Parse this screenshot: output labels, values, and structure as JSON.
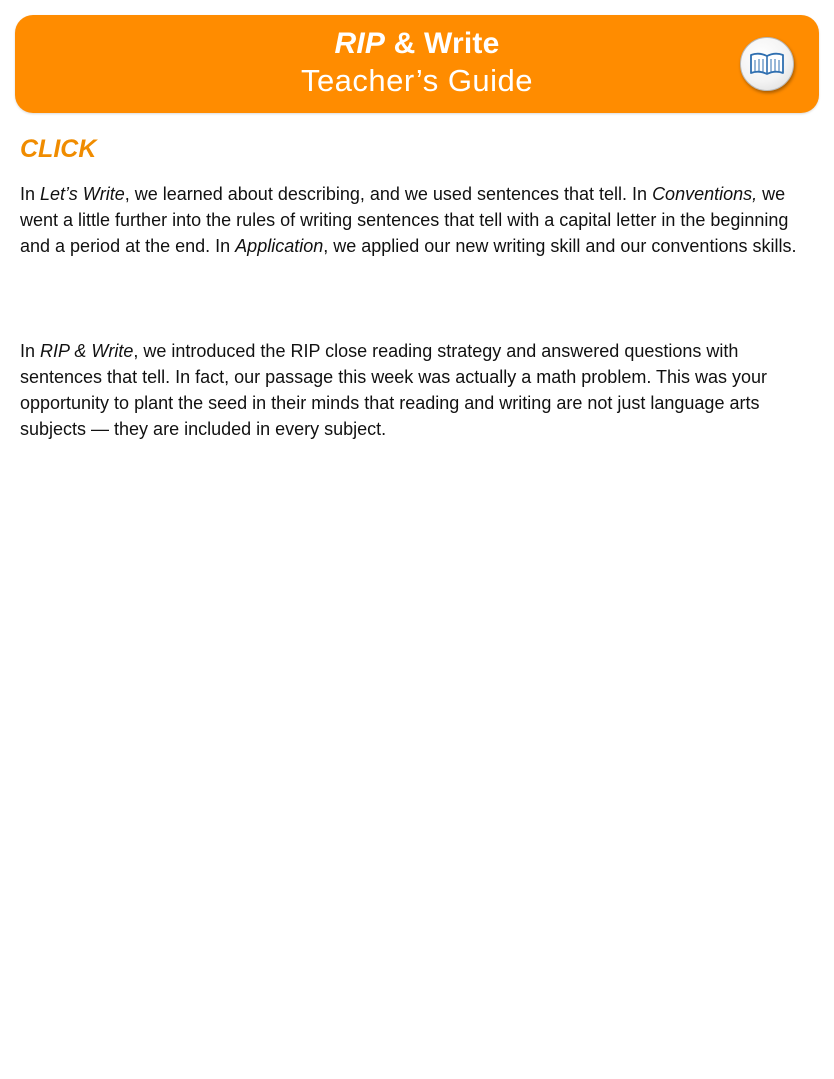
{
  "header": {
    "title_italic": "RIP",
    "title_rest": " & Write",
    "subtitle": "Teacher’s Guide",
    "icon": "book-icon",
    "color": "#ff8c00"
  },
  "section": {
    "heading": "CLICK",
    "heading_color": "#f08c00"
  },
  "paragraphs": {
    "p1": {
      "s1": "In ",
      "e1": "Let’s Write",
      "s2": ", we learned about describing, and we used sentences that tell. In ",
      "e2": "Conventions,",
      "s3": " we went a little further into the rules of writing sentences that tell with a capital letter in the beginning and a period at the end. In ",
      "e3": "Application",
      "s4": ", we applied our new writing skill and our conventions skills."
    },
    "p2": {
      "s1": "In ",
      "e1": "RIP & Write",
      "s2": ", we introduced the RIP close reading strategy and answered questions with sentences that tell. In fact, our passage this week was actually a math problem. This was your opportunity to plant the seed in their minds that reading and writing are not just language arts subjects — they are included in every subject."
    }
  }
}
